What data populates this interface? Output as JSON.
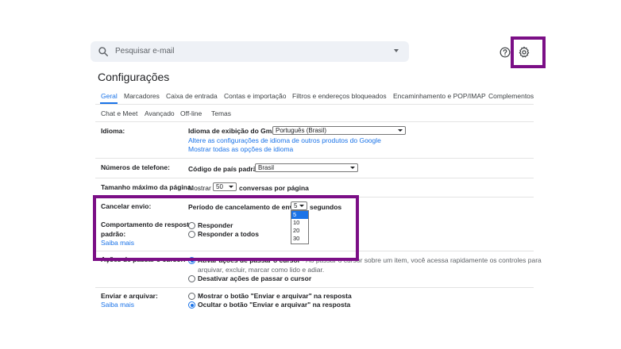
{
  "search": {
    "placeholder": "Pesquisar e-mail",
    "icon": "search-icon"
  },
  "header": {
    "help_icon": "help-icon",
    "settings_icon": "gear-icon",
    "highlight_color": "#7b0f86"
  },
  "page_title": "Configurações",
  "tabs_row1": [
    "Geral",
    "Marcadores",
    "Caixa de entrada",
    "Contas e importação",
    "Filtros e endereços bloqueados",
    "Encaminhamento e POP/IMAP",
    "Complementos"
  ],
  "tabs_row2": [
    "Chat e Meet",
    "Avançado",
    "Off-line",
    "Temas"
  ],
  "active_tab": "Geral",
  "language": {
    "label": "Idioma:",
    "display_label": "Idioma de exibição do Gmail:",
    "display_value": "Português (Brasil)",
    "link1": "Altere as configurações de idioma de outros produtos do Google",
    "link2": "Mostrar todas as opções de idioma"
  },
  "phone": {
    "label": "Números de telefone:",
    "code_label": "Código de país padrão:",
    "code_value": "Brasil"
  },
  "page_size": {
    "label": "Tamanho máximo da página:",
    "prefix": "Mostrar",
    "value": "50",
    "suffix": "conversas por página"
  },
  "undo_send": {
    "label": "Cancelar envio:",
    "period_label": "Período de cancelamento de envio:",
    "value": "5",
    "suffix": "segundos",
    "options": [
      "5",
      "10",
      "20",
      "30"
    ],
    "selected_option": "5"
  },
  "reply_behavior": {
    "label_line1": "Comportamento de resposta",
    "label_line2": "padrão:",
    "learn_more": "Saiba mais",
    "options": [
      "Responder",
      "Responder a todos"
    ]
  },
  "hover_actions": {
    "label": "Ações de passar o cursor:",
    "option1_bold": "Ativar ações de passar o cursor",
    "option1_desc": " - Ao passar o cursor sobre um item, você acessa rapidamente os controles para",
    "option1_desc2": "arquivar, excluir, marcar como lido e adiar.",
    "option2": "Desativar ações de passar o cursor"
  },
  "send_archive": {
    "label": "Enviar e arquivar:",
    "learn_more": "Saiba mais",
    "option1": "Mostrar o botão \"Enviar e arquivar\" na resposta",
    "option2": "Ocultar o botão \"Enviar e arquivar\" na resposta"
  }
}
